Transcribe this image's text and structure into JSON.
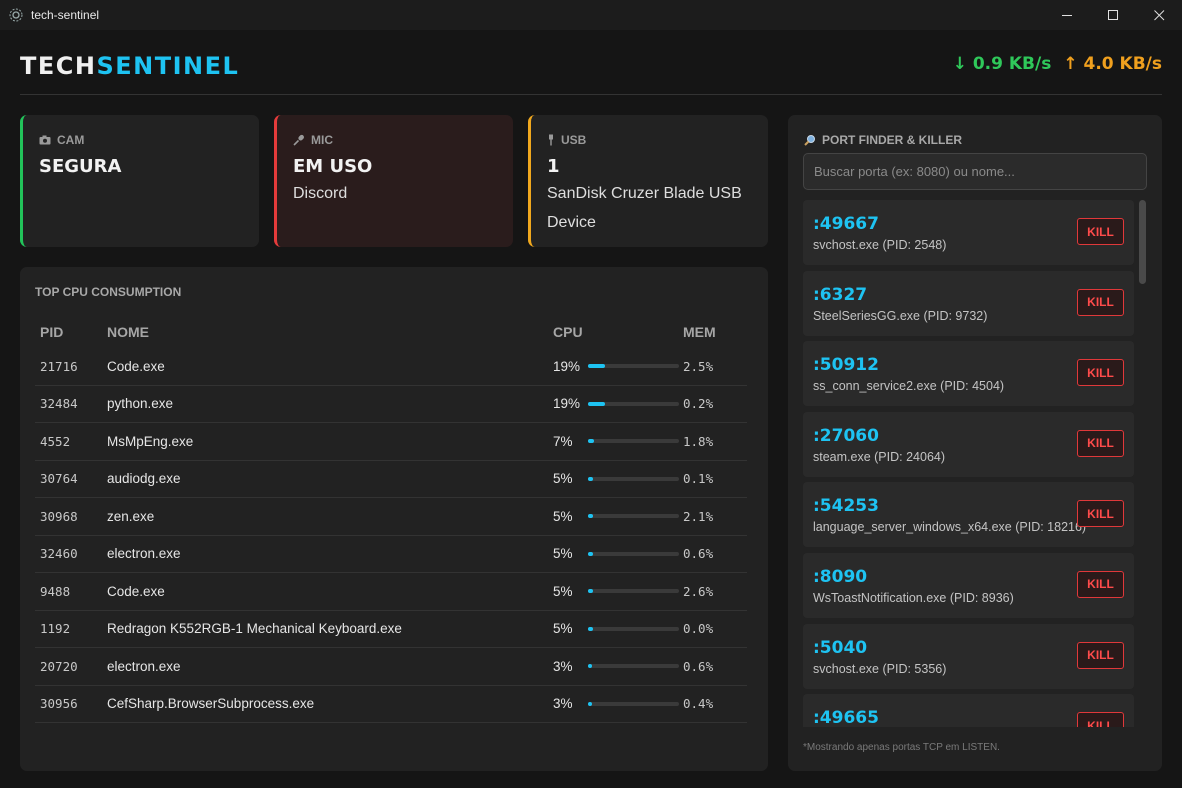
{
  "window": {
    "title": "tech-sentinel"
  },
  "header": {
    "brand_a": "TECH",
    "brand_b": "SENTINEL",
    "download": "↓ 0.9 KB/s",
    "upload": "↑ 4.0 KB/s"
  },
  "devices": {
    "cam": {
      "label": "CAM",
      "status": "SEGURA",
      "icon": "camera-icon"
    },
    "mic": {
      "label": "MIC",
      "status": "EM USO",
      "detail": "Discord",
      "icon": "microphone-icon"
    },
    "usb": {
      "label": "USB",
      "status": "1",
      "detail": "SanDisk Cruzer Blade USB Device",
      "icon": "usb-icon"
    }
  },
  "cpu": {
    "title": "TOP CPU CONSUMPTION",
    "headers": {
      "pid": "PID",
      "name": "NOME",
      "cpu": "CPU",
      "mem": "MEM"
    },
    "rows": [
      {
        "pid": "21716",
        "name": "Code.exe",
        "cpu": "19%",
        "cpu_value": 19,
        "mem": "2.5%"
      },
      {
        "pid": "32484",
        "name": "python.exe",
        "cpu": "19%",
        "cpu_value": 19,
        "mem": "0.2%"
      },
      {
        "pid": "4552",
        "name": "MsMpEng.exe",
        "cpu": "7%",
        "cpu_value": 7,
        "mem": "1.8%"
      },
      {
        "pid": "30764",
        "name": "audiodg.exe",
        "cpu": "5%",
        "cpu_value": 5,
        "mem": "0.1%"
      },
      {
        "pid": "30968",
        "name": "zen.exe",
        "cpu": "5%",
        "cpu_value": 5,
        "mem": "2.1%"
      },
      {
        "pid": "32460",
        "name": "electron.exe",
        "cpu": "5%",
        "cpu_value": 5,
        "mem": "0.6%"
      },
      {
        "pid": "9488",
        "name": "Code.exe",
        "cpu": "5%",
        "cpu_value": 5,
        "mem": "2.6%"
      },
      {
        "pid": "1192",
        "name": "Redragon K552RGB-1 Mechanical Keyboard.exe",
        "cpu": "5%",
        "cpu_value": 5,
        "mem": "0.0%"
      },
      {
        "pid": "20720",
        "name": "electron.exe",
        "cpu": "3%",
        "cpu_value": 3,
        "mem": "0.6%"
      },
      {
        "pid": "30956",
        "name": "CefSharp.BrowserSubprocess.exe",
        "cpu": "3%",
        "cpu_value": 3,
        "mem": "0.4%"
      }
    ]
  },
  "ports": {
    "title": "PORT FINDER & KILLER",
    "search_placeholder": "Buscar porta (ex: 8080) ou nome...",
    "search_value": "",
    "kill_label": "KILL",
    "items": [
      {
        "port": ":49667",
        "proc": "svchost.exe (PID: 2548)"
      },
      {
        "port": ":6327",
        "proc": "SteelSeriesGG.exe (PID: 9732)"
      },
      {
        "port": ":50912",
        "proc": "ss_conn_service2.exe (PID: 4504)"
      },
      {
        "port": ":27060",
        "proc": "steam.exe (PID: 24064)"
      },
      {
        "port": ":54253",
        "proc": "language_server_windows_x64.exe (PID: 18216)"
      },
      {
        "port": ":8090",
        "proc": "WsToastNotification.exe (PID: 8936)"
      },
      {
        "port": ":5040",
        "proc": "svchost.exe (PID: 5356)"
      },
      {
        "port": ":49665",
        "proc": ""
      }
    ],
    "note": "*Mostrando apenas portas TCP em LISTEN."
  },
  "colors": {
    "accent": "#1ec3f2",
    "safe": "#22c35a",
    "danger": "#e53b3b",
    "warning": "#f0a81e"
  }
}
